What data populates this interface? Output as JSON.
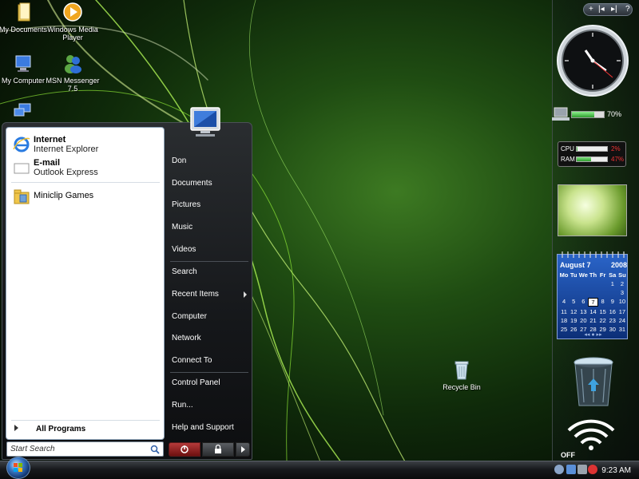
{
  "desktop": {
    "icons": [
      {
        "label": "My Documents",
        "icon": "folder-icon"
      },
      {
        "label": "Windows Media Player",
        "icon": "media-player-icon"
      },
      {
        "label": "My Computer",
        "icon": "computer-icon"
      },
      {
        "label": "MSN Messenger 7.5",
        "icon": "messenger-icon"
      },
      {
        "label": "Recycle Bin",
        "icon": "recycle-bin-icon"
      }
    ]
  },
  "start_menu": {
    "pinned": [
      {
        "title": "Internet",
        "subtitle": "Internet Explorer",
        "icon": "internet-explorer-icon"
      },
      {
        "title": "E-mail",
        "subtitle": "Outlook Express",
        "icon": "outlook-express-icon"
      }
    ],
    "recent": [
      {
        "title": "Miniclip Games",
        "icon": "miniclip-icon"
      }
    ],
    "all_programs": "All Programs",
    "search_placeholder": "Start Search",
    "right_items": [
      "Don",
      "Documents",
      "Pictures",
      "Music",
      "Videos",
      "Search",
      "Recent Items",
      "Computer",
      "Network",
      "Connect To",
      "Control Panel",
      "Run...",
      "Help and Support"
    ]
  },
  "sidebar": {
    "controls": [
      "+",
      "|◂",
      "▸|",
      "?"
    ],
    "battery_percent": "70%",
    "battery_level": 0.7,
    "cpu_label": "CPU",
    "cpu_value": "2%",
    "cpu_level": 0.02,
    "ram_label": "RAM",
    "ram_value": "47%",
    "ram_level": 0.47,
    "calendar": {
      "month": "August 7",
      "year": "2008",
      "weekdays": [
        "Mo",
        "Tu",
        "We",
        "Th",
        "Fr",
        "Sa",
        "Su"
      ],
      "rows": [
        [
          "",
          "",
          "",
          "",
          "",
          "1",
          "2"
        ],
        [
          "",
          "",
          "",
          "",
          "",
          "",
          "3"
        ],
        [
          "4",
          "5",
          "6",
          "7",
          "8",
          "9",
          "10"
        ],
        [
          "11",
          "12",
          "13",
          "14",
          "15",
          "16",
          "17"
        ],
        [
          "18",
          "19",
          "20",
          "21",
          "22",
          "23",
          "24"
        ],
        [
          "25",
          "26",
          "27",
          "28",
          "29",
          "30",
          "31"
        ]
      ],
      "today": "7"
    },
    "wifi_label": "OFF"
  },
  "taskbar": {
    "time": "9:23 AM"
  },
  "colors": {
    "accent_blue": "#2a64c8",
    "power_red": "#b53a3a",
    "meter_green": "#2f9e2f"
  }
}
